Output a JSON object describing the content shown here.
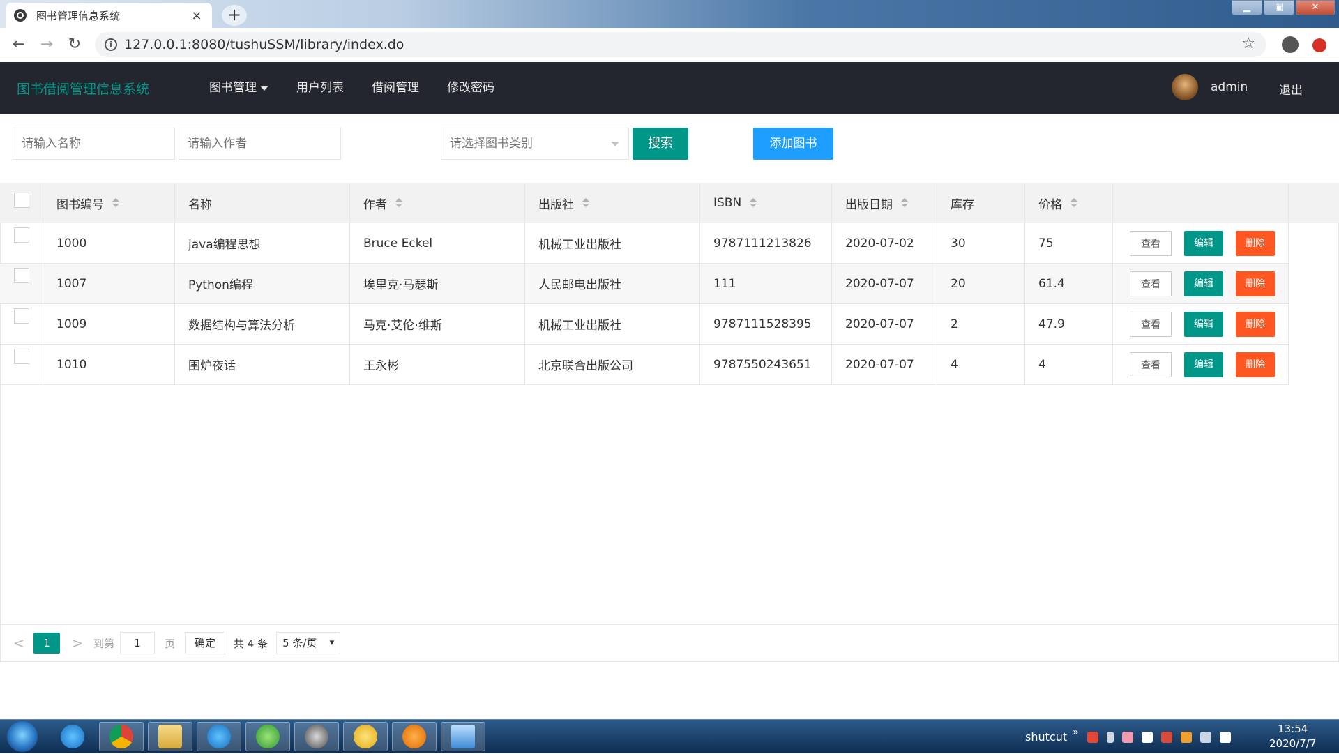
{
  "browser": {
    "tab_title": "图书管理信息系统",
    "tab_close": "×",
    "new_tab": "+",
    "url": "127.0.0.1:8080/tushuSSM/library/index.do",
    "win_min": "▁",
    "win_max": "▣",
    "win_close": "✕",
    "back": "←",
    "forward": "→",
    "reload": "↻",
    "info": "i",
    "star": "☆"
  },
  "header": {
    "logo": "图书借阅管理信息系统",
    "nav": [
      "图书管理",
      "用户列表",
      "借阅管理",
      "修改密码"
    ],
    "username": "admin",
    "logout": "退出"
  },
  "search": {
    "name_placeholder": "请输入名称",
    "author_placeholder": "请输入作者",
    "category_placeholder": "请选择图书类别",
    "search_button": "搜索",
    "add_button": "添加图书"
  },
  "table": {
    "columns": [
      "图书编号",
      "名称",
      "作者",
      "出版社",
      "ISBN",
      "出版日期",
      "库存",
      "价格"
    ],
    "rows": [
      [
        "1000",
        "java编程思想",
        "Bruce Eckel",
        "机械工业出版社",
        "9787111213826",
        "2020-07-02",
        "30",
        "75"
      ],
      [
        "1007",
        "Python编程",
        "埃里克·马瑟斯",
        "人民邮电出版社",
        "111",
        "2020-07-07",
        "20",
        "61.4"
      ],
      [
        "1009",
        "数据结构与算法分析",
        "马克·艾伦·维斯",
        "机械工业出版社",
        "9787111528395",
        "2020-07-07",
        "2",
        "47.9"
      ],
      [
        "1010",
        "围炉夜话",
        "王永彬",
        "北京联合出版公司",
        "9787550243651",
        "2020-07-07",
        "4",
        "4"
      ]
    ],
    "ops": {
      "view": "查看",
      "edit": "编辑",
      "delete": "删除"
    }
  },
  "pager": {
    "prev": "<",
    "current": "1",
    "next": ">",
    "goto_label": "到第",
    "goto_value": "1",
    "page_label": "页",
    "confirm": "确定",
    "total": "共 4 条",
    "page_size": "5 条/页"
  },
  "taskbar": {
    "tray_label": "shutcut",
    "tray_more": "»",
    "time": "13:54",
    "date": "2020/7/7"
  }
}
